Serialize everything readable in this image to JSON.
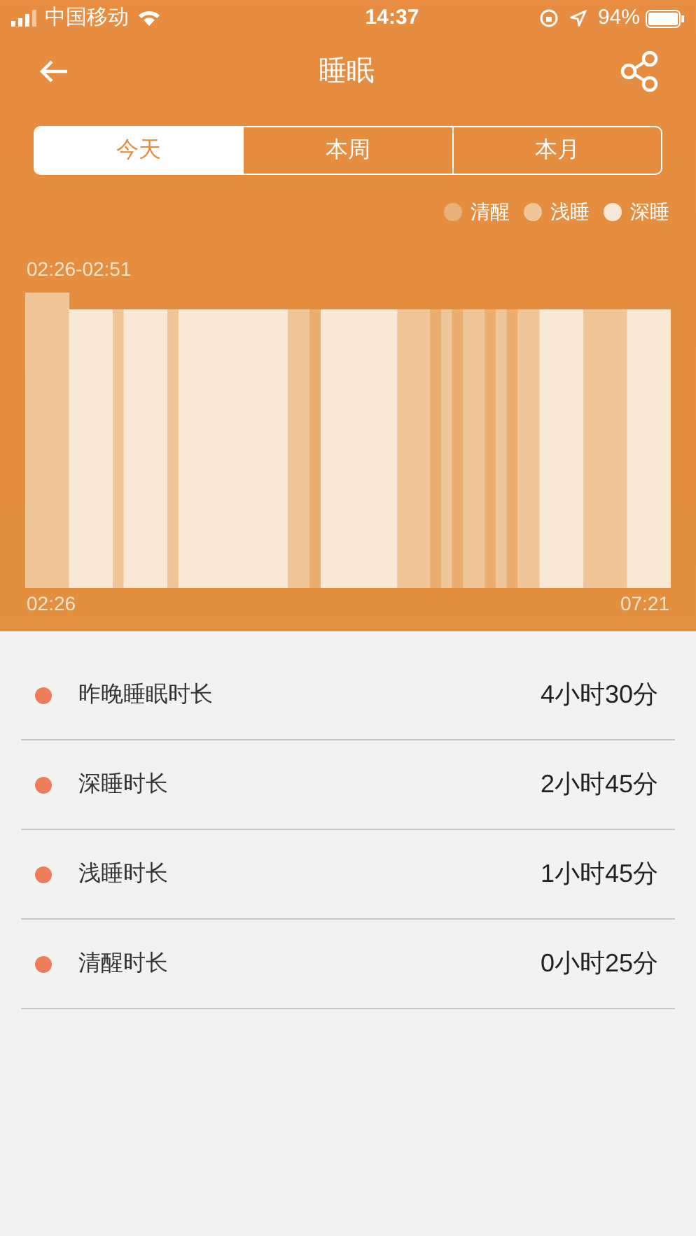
{
  "status_bar": {
    "carrier": "中国移动",
    "time": "14:37",
    "battery": "94%"
  },
  "header": {
    "title": "睡眠"
  },
  "tabs": [
    {
      "label": "今天",
      "selected": true
    },
    {
      "label": "本周",
      "selected": false
    },
    {
      "label": "本月",
      "selected": false
    }
  ],
  "legend": [
    {
      "label": "清醒",
      "color": "#e9b07c"
    },
    {
      "label": "浅睡",
      "color": "#f0c597"
    },
    {
      "label": "深睡",
      "color": "#f9e8d6"
    }
  ],
  "chart": {
    "range_label": "02:26-02:51",
    "start": "02:26",
    "end": "07:21"
  },
  "stats": [
    {
      "label": "昨晚睡眠时长",
      "value": "4小时30分"
    },
    {
      "label": "深睡时长",
      "value": "2小时45分"
    },
    {
      "label": "浅睡时长",
      "value": "1小时45分"
    },
    {
      "label": "清醒时长",
      "value": "0小时25分"
    }
  ]
}
